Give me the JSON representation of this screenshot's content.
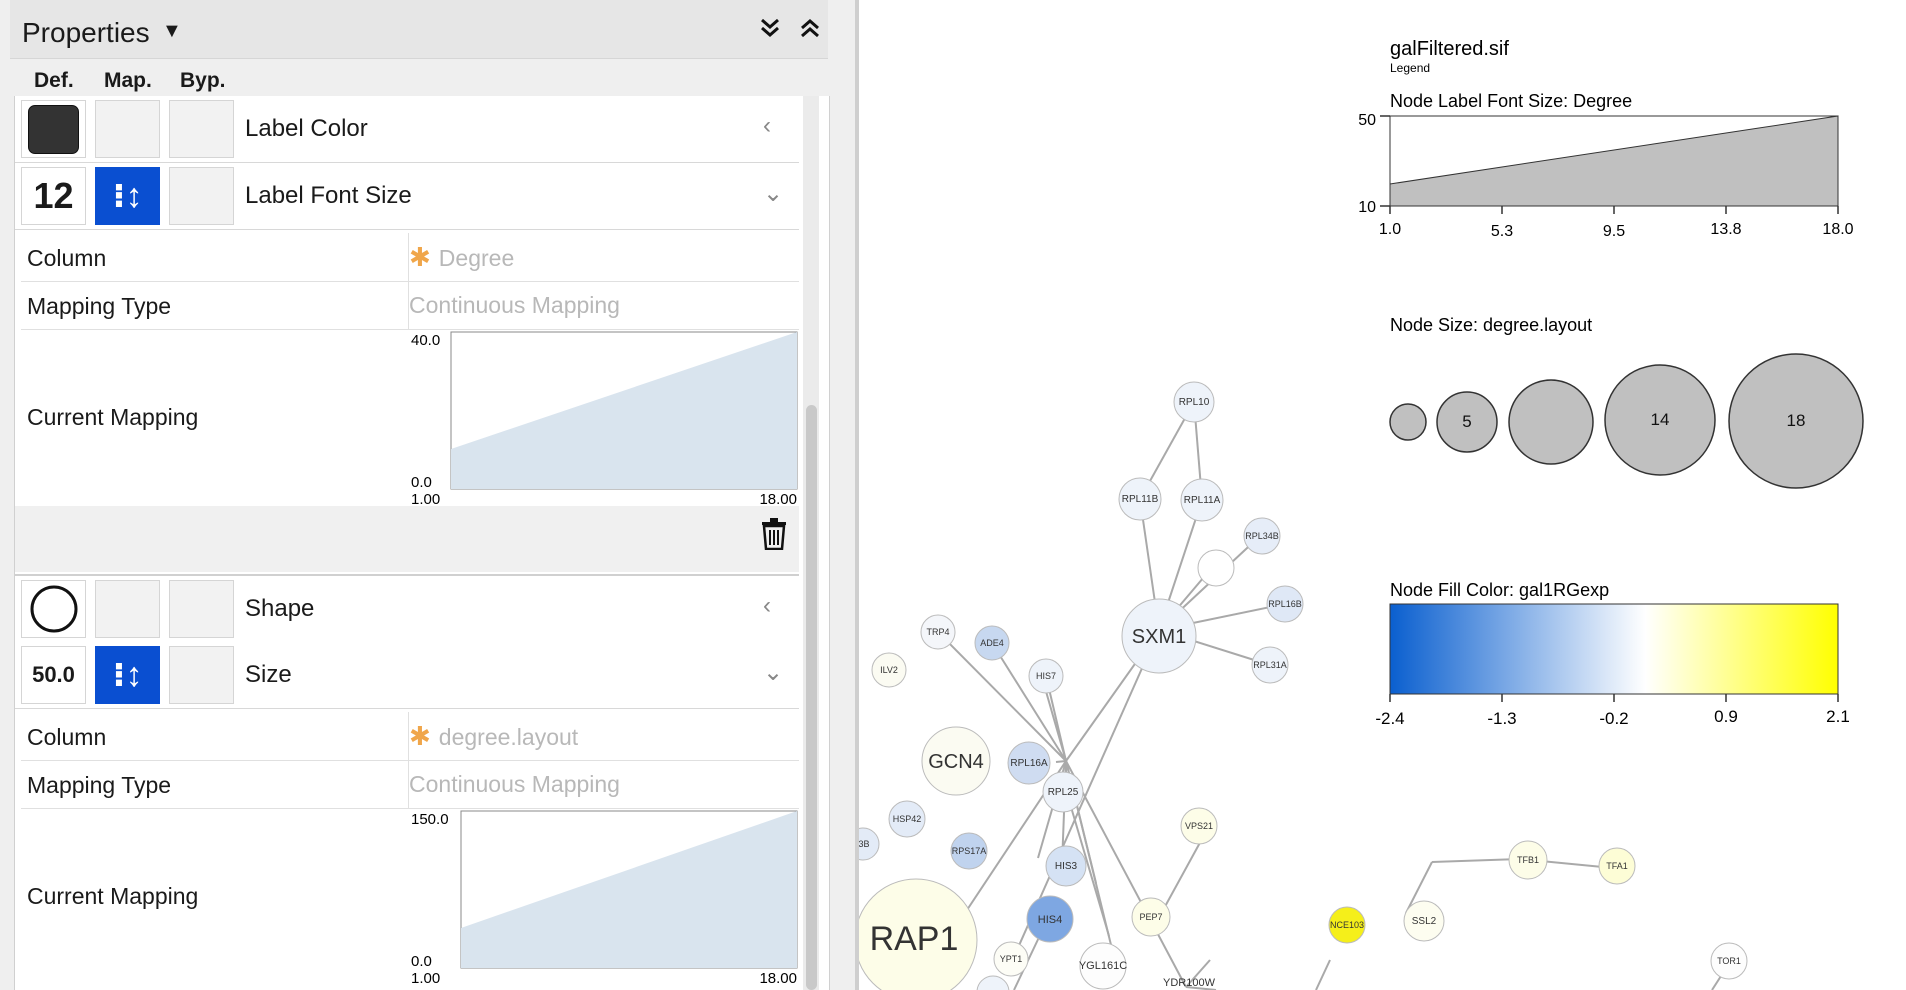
{
  "panel": {
    "title": "Properties",
    "title_dropdown_icon": "triangle-down-icon",
    "expand_icon": "double-chevron-down-icon",
    "collapse_icon": "double-chevron-up-icon",
    "column_headers": {
      "def": "Def.",
      "map": "Map.",
      "byp": "Byp."
    },
    "properties": [
      {
        "label": "Label Color",
        "def_value": "",
        "collapsed": true
      },
      {
        "label": "Label Font Size",
        "def_value": "12",
        "mapped": true,
        "expanded": true,
        "details": {
          "column_label": "Column",
          "column_value": "Degree",
          "mapping_type_label": "Mapping Type",
          "mapping_type_value": "Continuous Mapping",
          "current_mapping_label": "Current Mapping",
          "y_max": "40.0",
          "y_min": "0.0",
          "x_min": "1.00",
          "x_max": "18.00"
        }
      },
      {
        "label": "Shape",
        "def_value": "",
        "collapsed": true
      },
      {
        "label": "Size",
        "def_value": "50.0",
        "mapped": true,
        "expanded": true,
        "details": {
          "column_label": "Column",
          "column_value": "degree.layout",
          "mapping_type_label": "Mapping Type",
          "mapping_type_value": "Continuous Mapping",
          "current_mapping_label": "Current Mapping",
          "y_max": "150.0",
          "y_min": "0.0",
          "x_min": "1.00",
          "x_max": "18.00"
        }
      }
    ]
  },
  "legend": {
    "file": "galFiltered.sif",
    "subtitle": "Legend",
    "font_size": {
      "title": "Node Label Font Size:  Degree",
      "y_ticks": [
        "50",
        "10"
      ],
      "x_ticks": [
        "1.0",
        "5.3",
        "9.5",
        "13.8",
        "18.0"
      ]
    },
    "node_size": {
      "title": "Node Size:  degree.layout",
      "labels": [
        "",
        "5",
        "",
        "14",
        "18"
      ]
    },
    "fill_color": {
      "title": "Node Fill Color:  gal1RGexp",
      "ticks": [
        "-2.4",
        "-1.3",
        "-0.2",
        "0.9",
        "2.1"
      ]
    }
  },
  "network": {
    "nodes": [
      "RPL10",
      "RPL11B",
      "RPL11A",
      "RPL34B",
      "RPL16B",
      "RPL31A",
      "SXM1",
      "TRP4",
      "ADE4",
      "ILV2",
      "HIS7",
      "GCN4",
      "RPL16A",
      "RPL25",
      "HSP42",
      "RPS17A",
      "HIS3",
      "HIS4",
      "VPS21",
      "PEP7",
      "RAP1",
      "YPT1",
      "YGL161C",
      "YDR100W",
      "NCE103",
      "SSL2",
      "TFB1",
      "TFA1",
      "TOR1",
      "3B"
    ]
  },
  "colors": {
    "mapping_blue": "#0a4fd1",
    "legend_gray": "#c0c0c0",
    "gradient_low": "#0a5fcf",
    "gradient_mid": "#ffffff",
    "gradient_high": "#ffff00"
  }
}
